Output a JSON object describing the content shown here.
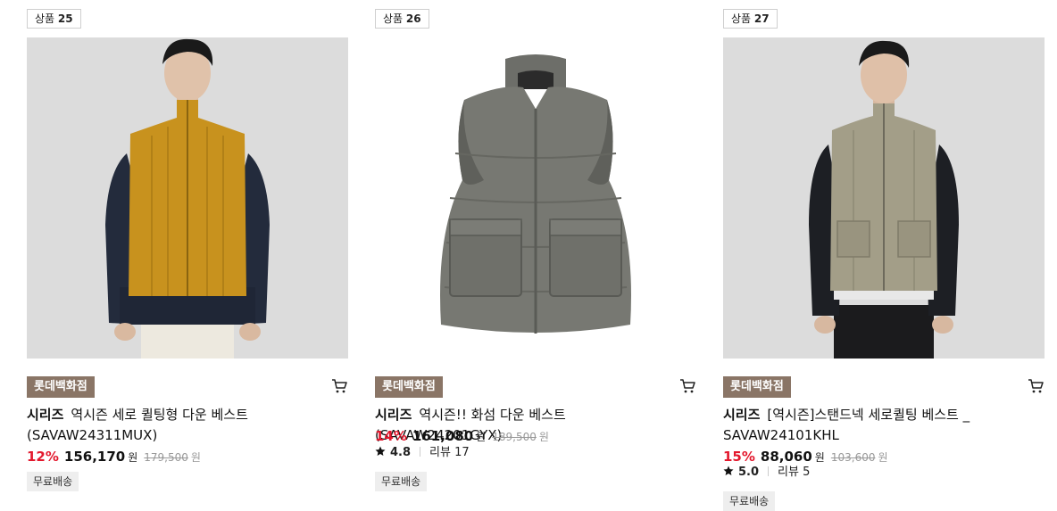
{
  "products": [
    {
      "badge_prefix": "상품",
      "badge_number": "25",
      "store": "롯데백화점",
      "brand": "시리즈",
      "name": "역시즌 세로 퀼팅형 다운 베스트 (SAVAW24311MUX)",
      "discount": "12%",
      "sale_price": "156,170",
      "currency": "원",
      "original_price": "179,500",
      "shipping": "무료배송",
      "vest_color": "#c8921e"
    },
    {
      "badge_prefix": "상품",
      "badge_number": "26",
      "store": "롯데백화점",
      "brand": "시리즈",
      "name": "역시즌!! 화섬 다운 베스트(SAVAW24201GYX)",
      "discount": "14%",
      "sale_price": "161,080",
      "currency": "원",
      "original_price": "189,500",
      "rating": "4.8",
      "review_label": "리뷰 17",
      "shipping": "무료배송",
      "vest_color": "#777872"
    },
    {
      "badge_prefix": "상품",
      "badge_number": "27",
      "store": "롯데백화점",
      "brand": "시리즈",
      "name": "[역시즌]스탠드넥 세로퀼팅 베스트 _ SAVAW24101KHL",
      "discount": "15%",
      "sale_price": "88,060",
      "currency": "원",
      "original_price": "103,600",
      "rating": "5.0",
      "review_label": "리뷰 5",
      "shipping": "무료배송",
      "vest_color": "#a39e88"
    }
  ],
  "icons": {
    "cart": "cart-icon",
    "star": "star-icon"
  },
  "colors": {
    "discount": "#e3182d",
    "store_badge": "#8a7566"
  }
}
